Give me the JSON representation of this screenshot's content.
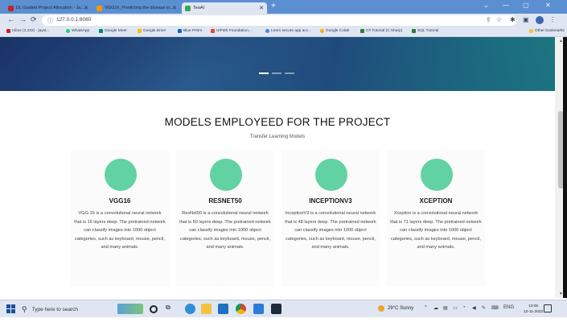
{
  "browser": {
    "tabs": [
      {
        "label": "DL Guided Project Allocation - Ja...",
        "favicon_color": "#c5221f",
        "active": false
      },
      {
        "label": "VGG16_Predicting the disease in...",
        "favicon_color": "#f29900",
        "active": false
      },
      {
        "label": "TeaAI",
        "favicon_color": "#34a853",
        "active": true
      }
    ],
    "new_tab_glyph": "+",
    "window_controls": {
      "minimize": "—",
      "restore": "▢",
      "close": "✕",
      "collapse": "⌄"
    },
    "nav": {
      "back": "←",
      "forward": "→",
      "reload": "⟳"
    },
    "url": "127.0.0.1:8080",
    "bookmarks": [
      {
        "label": "Inbox (2,332) - jayst...",
        "color": "#c5221f"
      },
      {
        "label": "WhatsApp",
        "color": "#25d366"
      },
      {
        "label": "Google Meet",
        "color": "#00897b"
      },
      {
        "label": "Google Drive",
        "color": "#fbbc04"
      },
      {
        "label": "Blue Prism",
        "color": "#1565c0"
      },
      {
        "label": "UiPath Foundation...",
        "color": "#e8452e"
      },
      {
        "label": "Learn secure app acc...",
        "color": "#4285f4"
      },
      {
        "label": "Google Colab",
        "color": "#f9ab00"
      },
      {
        "label": "C# Tutorial (C Sharp)",
        "color": "#2e7d32"
      },
      {
        "label": "SQL Tutorial",
        "color": "#2e7d32"
      }
    ],
    "other_bookmarks": "Other bookmarks"
  },
  "page": {
    "heading": "MODELS EMPLOYEED FOR THE PROJECT",
    "subheading": "Transfer Learning Models",
    "accent_color": "#62d2a2",
    "carousel": {
      "indicators": 3,
      "active_index": 0
    },
    "models": [
      {
        "name": "VGG16",
        "description": "VGG-16 is a convolutional neural network that is 16 layers deep. The pretrained network can classify images into 1000 object categories, such as keyboard, mouse, pencil, and many animals."
      },
      {
        "name": "RESNET50",
        "description": "ResNet50 is a convolutional neural network that is 50 layers deep. The pretrained network can classify images into 1000 object categories, such as keyboard, mouse, pencil, and many animals."
      },
      {
        "name": "INCEPTIONV3",
        "description": "InceptionV3 is a convolutional neural network that is 48 layers deep. The pretrained network can classify images into 1000 object categories, such as keyboard, mouse, pencil, and many animals."
      },
      {
        "name": "XCEPTION",
        "description": "Xception is a convolutional neural network that is 71 layers deep. The pretrained network can classify images into 1000 object categories, such as keyboard, mouse, pencil, and many animals."
      }
    ]
  },
  "taskbar": {
    "search_placeholder": "Type here to search",
    "weather": "29°C  Sunny",
    "language": "ENG",
    "time": "13:05",
    "date": "12-11-2022"
  }
}
